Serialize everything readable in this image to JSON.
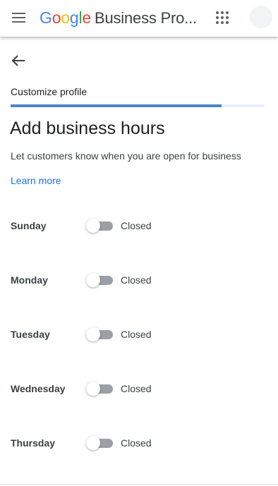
{
  "header": {
    "logo_letters": [
      {
        "char": "G",
        "color": "#4285F4"
      },
      {
        "char": "o",
        "color": "#EA4335"
      },
      {
        "char": "o",
        "color": "#FBBC05"
      },
      {
        "char": "g",
        "color": "#4285F4"
      },
      {
        "char": "l",
        "color": "#34A853"
      },
      {
        "char": "e",
        "color": "#EA4335"
      }
    ],
    "product_name": "Business Pro...",
    "menu_icon": "hamburger-menu-icon",
    "apps_icon": "apps-grid-icon",
    "avatar_icon": "account-avatar"
  },
  "nav": {
    "back_icon": "arrow-back-icon"
  },
  "step": {
    "label": "Customize profile",
    "progress_fraction": 0.83,
    "progress_color": "#4a86c8"
  },
  "page": {
    "title": "Add business hours",
    "subtitle": "Let customers know when you are open for business",
    "learn_more": "Learn more"
  },
  "days": [
    {
      "name": "Sunday",
      "status": "Closed",
      "open": false
    },
    {
      "name": "Monday",
      "status": "Closed",
      "open": false
    },
    {
      "name": "Tuesday",
      "status": "Closed",
      "open": false
    },
    {
      "name": "Wednesday",
      "status": "Closed",
      "open": false
    },
    {
      "name": "Thursday",
      "status": "Closed",
      "open": false
    }
  ]
}
